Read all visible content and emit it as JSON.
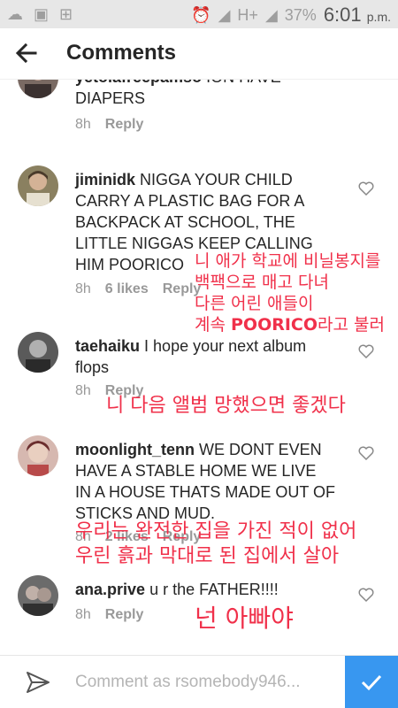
{
  "status_bar": {
    "network": "H+",
    "battery": "37%",
    "time": "6:01",
    "ampm": "p.m."
  },
  "header": {
    "title": "Comments"
  },
  "comments": [
    {
      "username": "yetolafreepamso",
      "text": "ION HAVE DIAPERS",
      "time": "8h",
      "likes": "",
      "reply": "Reply"
    },
    {
      "username": "jiminidk",
      "text": "NIGGA YOUR CHILD CARRY A PLASTIC BAG FOR A BACKPACK AT SCHOOL, THE LITTLE NIGGAS KEEP CALLING HIM POORICO",
      "time": "8h",
      "likes": "6 likes",
      "reply": "Reply"
    },
    {
      "username": "taehaiku",
      "text": "I hope your next album flops",
      "time": "8h",
      "likes": "",
      "reply": "Reply"
    },
    {
      "username": "moonlight_tenn",
      "text": "WE DONT EVEN HAVE A STABLE HOME WE LIVE IN A HOUSE THATS MADE OUT OF STICKS AND MUD.",
      "time": "8h",
      "likes": "2 likes",
      "reply": "Reply"
    },
    {
      "username": "ana.prive",
      "text": "u r the FATHER!!!!",
      "time": "8h",
      "likes": "",
      "reply": "Reply"
    }
  ],
  "translations": {
    "jiminidk": [
      "니 애가 학교에 비닐봉지를",
      "백팩으로 매고 다녀",
      "다른 어린 애들이"
    ],
    "jiminidk_last_pre": "계속 ",
    "jiminidk_last_bold": "POORICO",
    "jiminidk_last_post": "라고 불러",
    "taehaiku": "니 다음 앨범 망했으면 좋겠다",
    "moonlight_1": "우리는 완전한 집을 가진 적이 없어",
    "moonlight_2": "우린 흙과 막대로 된 집에서 살아",
    "ana": "넌 아빠야"
  },
  "composer": {
    "placeholder": "Comment as rsomebody946..."
  },
  "colors": {
    "accent": "#3897f0",
    "annotation": "#f0304a"
  }
}
